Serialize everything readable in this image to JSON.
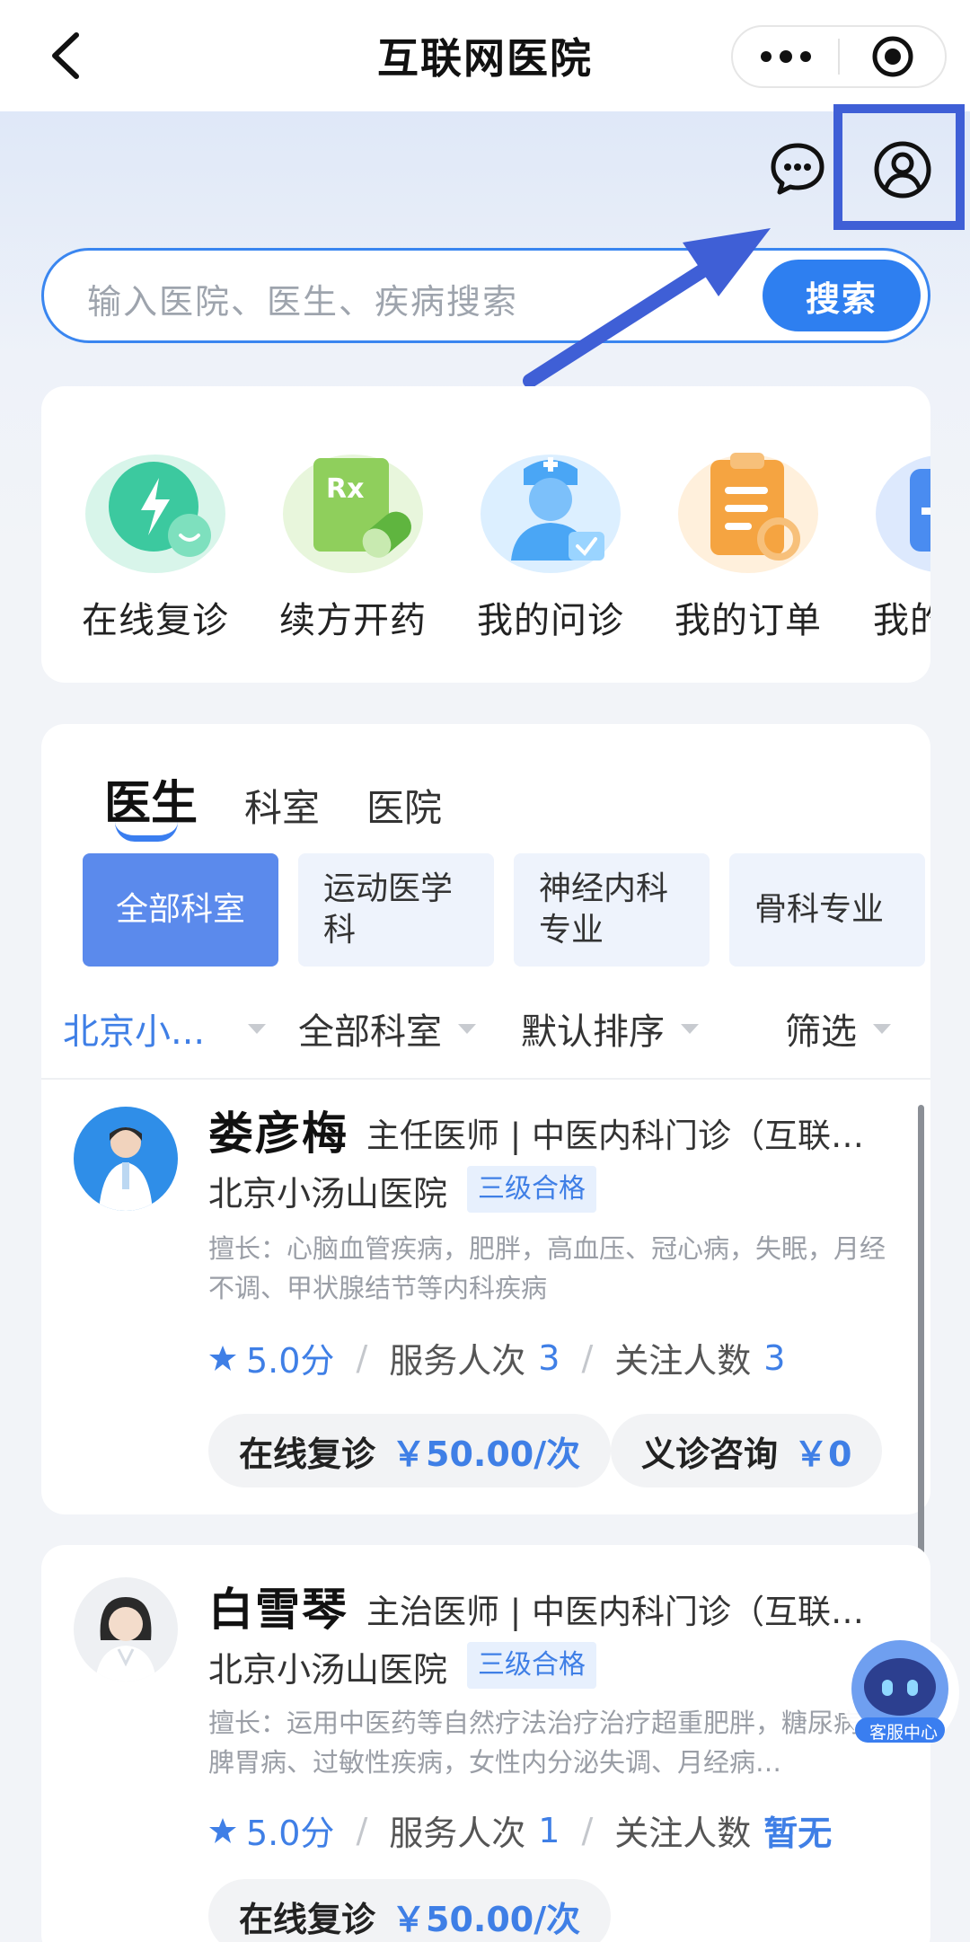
{
  "navbar": {
    "title": "互联网医院",
    "more_icon": "more-dots-icon",
    "target_icon": "target-circle-icon"
  },
  "header": {
    "message_icon": "chat-bubble-icon",
    "profile_icon": "user-profile-icon"
  },
  "search": {
    "placeholder": "输入医院、医生、疾病搜索",
    "button": "搜索"
  },
  "quick_actions": [
    {
      "label": "在线复诊",
      "icon": "online-revisit-icon",
      "color": "#3cc99f"
    },
    {
      "label": "续方开药",
      "icon": "prescription-rx-icon",
      "color": "#7bc95a"
    },
    {
      "label": "我的问诊",
      "icon": "doctor-consult-icon",
      "color": "#4aa6f5"
    },
    {
      "label": "我的订单",
      "icon": "order-clipboard-icon",
      "color": "#f5a441"
    },
    {
      "label": "我的",
      "icon": "partial-card-icon",
      "color": "#4a8cf0"
    }
  ],
  "tabs": [
    "医生",
    "科室",
    "医院"
  ],
  "chips": [
    "全部科室",
    "运动医学科",
    "神经内科专业",
    "骨科专业"
  ],
  "filters": [
    "北京小...",
    "全部科室",
    "默认排序",
    "筛选"
  ],
  "doctors": [
    {
      "name": "娄彦梅",
      "title": "主任医师 | 中医内科门诊（互联…",
      "hospital": "北京小汤山医院",
      "badge": "三级合格",
      "specialty": "擅长：心脑血管疾病，肥胖，高血压、冠心病，失眠，月经不调、甲状腺结节等内科疾病",
      "rating": "5.0分",
      "service_label": "服务人次",
      "service_value": "3",
      "follow_label": "关注人数",
      "follow_value": "3",
      "prices": [
        {
          "label": "在线复诊",
          "value": "￥50.00/次"
        },
        {
          "label": "义诊咨询",
          "value": "￥0"
        }
      ]
    },
    {
      "name": "白雪琴",
      "title": "主治医师 | 中医内科门诊（互联…",
      "hospital": "北京小汤山医院",
      "badge": "三级合格",
      "specialty": "擅长：运用中医药等自然疗法治疗治疗超重肥胖，糖尿病、脾胃病、过敏性疾病，女性内分泌失调、月经病…",
      "rating": "5.0分",
      "service_label": "服务人次",
      "service_value": "1",
      "follow_label": "关注人数",
      "follow_value": "暂无",
      "prices": [
        {
          "label": "在线复诊",
          "value": "￥50.00/次"
        }
      ]
    }
  ],
  "customer_service": {
    "label": "客服中心"
  },
  "colors": {
    "primary": "#2e7ff0",
    "highlight": "#3f5fd6",
    "chip_active": "#5b8aec"
  }
}
